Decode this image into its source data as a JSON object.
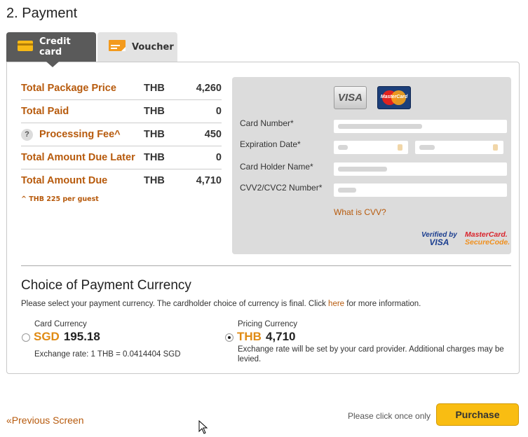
{
  "page": {
    "title": "2. Payment"
  },
  "tabs": [
    {
      "label": "Credit card",
      "icon": "credit-card-icon",
      "active": true
    },
    {
      "label": "Voucher",
      "icon": "voucher-icon",
      "active": false
    }
  ],
  "summary": {
    "rows": [
      {
        "label": "Total Package Price",
        "currency": "THB",
        "amount": "4,260"
      },
      {
        "label": "Total Paid",
        "currency": "THB",
        "amount": "0"
      },
      {
        "label": "Processing Fee^",
        "currency": "THB",
        "amount": "450",
        "help_icon": "?"
      },
      {
        "label": "Total Amount Due Later",
        "currency": "THB",
        "amount": "0"
      },
      {
        "label": "Total Amount Due",
        "currency": "THB",
        "amount": "4,710"
      }
    ],
    "note": "^ THB 225  per guest"
  },
  "card_form": {
    "brands": {
      "visa": "VISA",
      "mastercard": "MasterCard"
    },
    "fields": {
      "card_number": "Card Number*",
      "expiration": "Expiration Date*",
      "holder": "Card Holder Name*",
      "cvv": "CVV2/CVC2 Number*"
    },
    "cvv_link": "What is CVV?",
    "verified": {
      "line1": "Verified by",
      "line2": "VISA"
    },
    "securecode": {
      "line1": "MasterCard.",
      "line2": "SecureCode."
    }
  },
  "currency": {
    "title": "Choice of Payment Currency",
    "desc_before": "Please select your payment currency. The cardholder choice of currency is final. Click ",
    "desc_link": "here",
    "desc_after": " for more information.",
    "card": {
      "label": "Card Currency",
      "code": "SGD",
      "amount": "195.18",
      "note": "Exchange rate: 1 THB = 0.0414404 SGD",
      "selected": false
    },
    "pricing": {
      "label": "Pricing Currency",
      "code": "THB",
      "amount": "4,710",
      "note": "Exchange rate will be set by your card provider. Additional charges may be levied.",
      "selected": true
    }
  },
  "footer": {
    "prev": "«Previous Screen",
    "click_once": "Please click once only",
    "purchase": "Purchase"
  },
  "colors": {
    "accent": "#b75a0c",
    "button": "#f9bd12",
    "tab_active": "#5a5a5a"
  }
}
